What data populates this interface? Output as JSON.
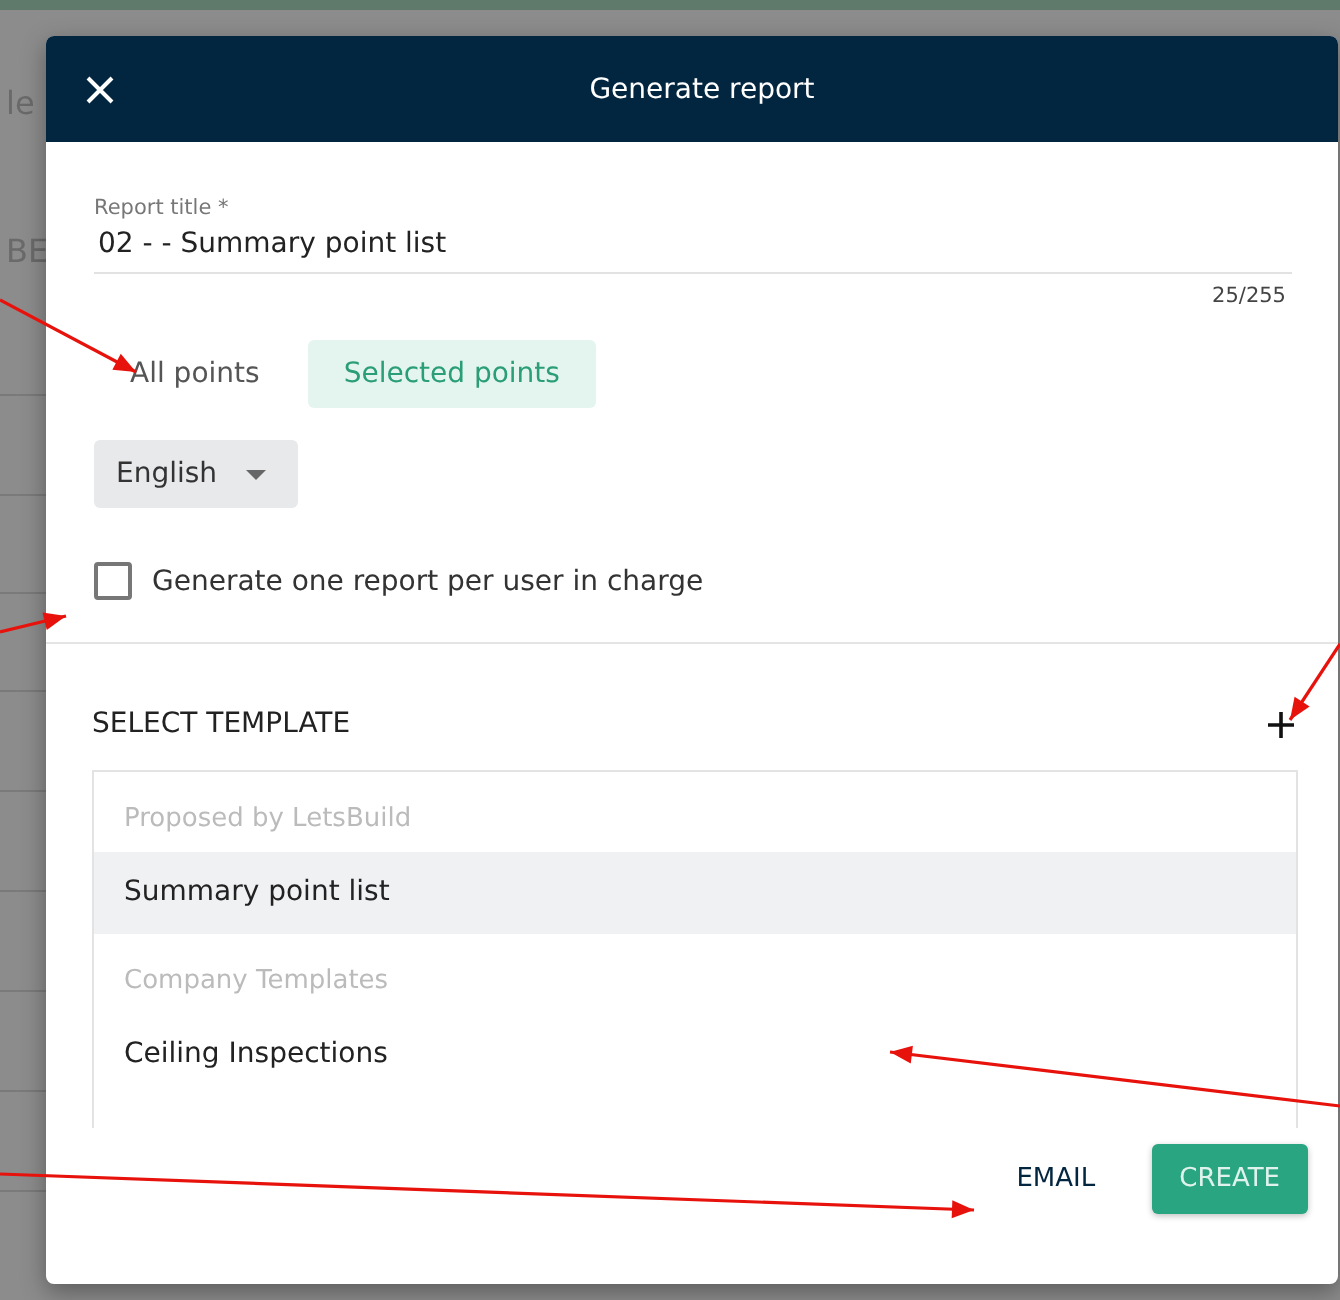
{
  "background_fragments": [
    "le",
    "BE"
  ],
  "dialog": {
    "title": "Generate report",
    "title_field": {
      "label": "Report title *",
      "value": "02 - - Summary point list",
      "counter": "25/255"
    },
    "scope_tabs": [
      {
        "label": "All points",
        "selected": false
      },
      {
        "label": "Selected points",
        "selected": true
      }
    ],
    "language": {
      "value": "English"
    },
    "per_user_checkbox": {
      "label": "Generate one report per user in charge",
      "checked": false
    },
    "templates": {
      "heading": "SELECT TEMPLATE",
      "groups": [
        {
          "heading": "Proposed by LetsBuild",
          "items": [
            {
              "label": "Summary point list",
              "selected": true
            }
          ]
        },
        {
          "heading": "Company Templates",
          "items": [
            {
              "label": "Ceiling Inspections",
              "selected": false
            }
          ]
        }
      ]
    },
    "buttons": [
      {
        "label": "EMAIL",
        "kind": "text"
      },
      {
        "label": "CREATE",
        "kind": "primary"
      }
    ]
  }
}
